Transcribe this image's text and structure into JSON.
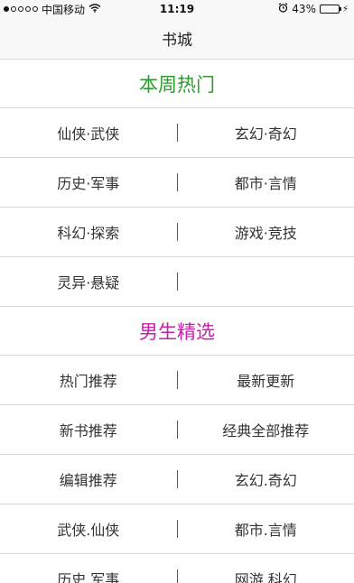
{
  "status_bar": {
    "carrier": "中国移动",
    "time": "11:19",
    "battery_percent": "43%",
    "battery_level": 0.43,
    "colors": {
      "battery_fill": "#4cd964"
    }
  },
  "nav": {
    "title": "书城"
  },
  "sections": [
    {
      "title": "本周热门",
      "color": "#2e9a2e",
      "rows": [
        [
          "仙侠·武侠",
          "玄幻·奇幻"
        ],
        [
          "历史·军事",
          "都市·言情"
        ],
        [
          "科幻·探索",
          "游戏·竞技"
        ],
        [
          "灵异·悬疑",
          ""
        ]
      ]
    },
    {
      "title": "男生精选",
      "color": "#c421a6",
      "rows": [
        [
          "热门推荐",
          "最新更新"
        ],
        [
          "新书推荐",
          "经典全部推荐"
        ],
        [
          "编辑推荐",
          "玄幻.奇幻"
        ],
        [
          "武侠.仙侠",
          "都市.言情"
        ],
        [
          "历史.军事",
          "网游.科幻"
        ]
      ]
    }
  ]
}
